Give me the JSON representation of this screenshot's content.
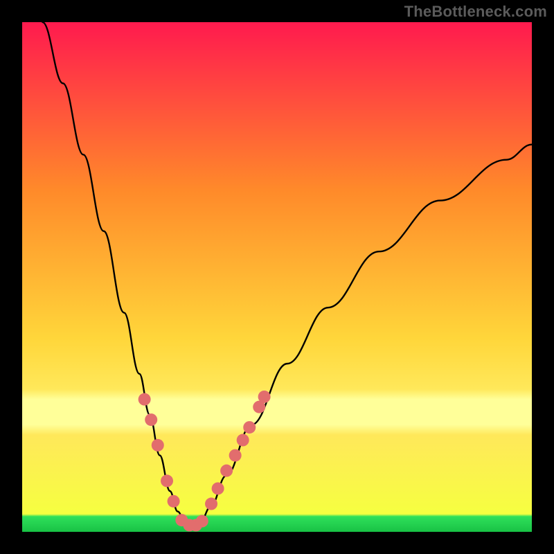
{
  "attribution": "TheBottleneck.com",
  "colors": {
    "bg": "#000000",
    "grad_top": "#ff1a4e",
    "grad_upper_mid": "#ff6a2a",
    "grad_mid": "#ffd63a",
    "grad_band": "#ffff99",
    "grad_bottom": "#2fe05a",
    "curve": "#000000",
    "marker": "#e26d6d"
  },
  "chart_data": {
    "type": "line",
    "title": "",
    "xlabel": "",
    "ylabel": "",
    "xlim": [
      0,
      100
    ],
    "ylim": [
      0,
      100
    ],
    "series": [
      {
        "name": "bottleneck-curve",
        "x": [
          4,
          8,
          12,
          16,
          20,
          23,
          25,
          27,
          29,
          30.5,
          32,
          33,
          34,
          35,
          37,
          40,
          45,
          52,
          60,
          70,
          82,
          95,
          100
        ],
        "values": [
          100,
          88,
          74,
          59,
          43,
          31,
          23,
          15,
          8,
          4,
          2,
          1.2,
          1.2,
          2,
          5,
          11,
          21,
          33,
          44,
          55,
          65,
          73,
          76
        ]
      }
    ],
    "markers": [
      {
        "series": "bottleneck-curve",
        "x": 24.0,
        "y": 26
      },
      {
        "series": "bottleneck-curve",
        "x": 25.3,
        "y": 22
      },
      {
        "series": "bottleneck-curve",
        "x": 26.6,
        "y": 17
      },
      {
        "series": "bottleneck-curve",
        "x": 28.4,
        "y": 10
      },
      {
        "series": "bottleneck-curve",
        "x": 29.7,
        "y": 6
      },
      {
        "series": "bottleneck-curve",
        "x": 31.3,
        "y": 2.3
      },
      {
        "series": "bottleneck-curve",
        "x": 32.8,
        "y": 1.3
      },
      {
        "series": "bottleneck-curve",
        "x": 34.1,
        "y": 1.3
      },
      {
        "series": "bottleneck-curve",
        "x": 35.3,
        "y": 2.1
      },
      {
        "series": "bottleneck-curve",
        "x": 37.1,
        "y": 5.5
      },
      {
        "series": "bottleneck-curve",
        "x": 38.4,
        "y": 8.5
      },
      {
        "series": "bottleneck-curve",
        "x": 40.1,
        "y": 12
      },
      {
        "series": "bottleneck-curve",
        "x": 41.8,
        "y": 15
      },
      {
        "series": "bottleneck-curve",
        "x": 43.3,
        "y": 18
      },
      {
        "series": "bottleneck-curve",
        "x": 44.6,
        "y": 20.5
      },
      {
        "series": "bottleneck-curve",
        "x": 46.5,
        "y": 24.5
      },
      {
        "series": "bottleneck-curve",
        "x": 47.5,
        "y": 26.5
      }
    ],
    "bands": [
      {
        "name": "pale-band",
        "y0": 22,
        "y1": 28
      },
      {
        "name": "green-band",
        "y0": 0,
        "y1": 3
      }
    ],
    "grid": false,
    "legend": false
  }
}
